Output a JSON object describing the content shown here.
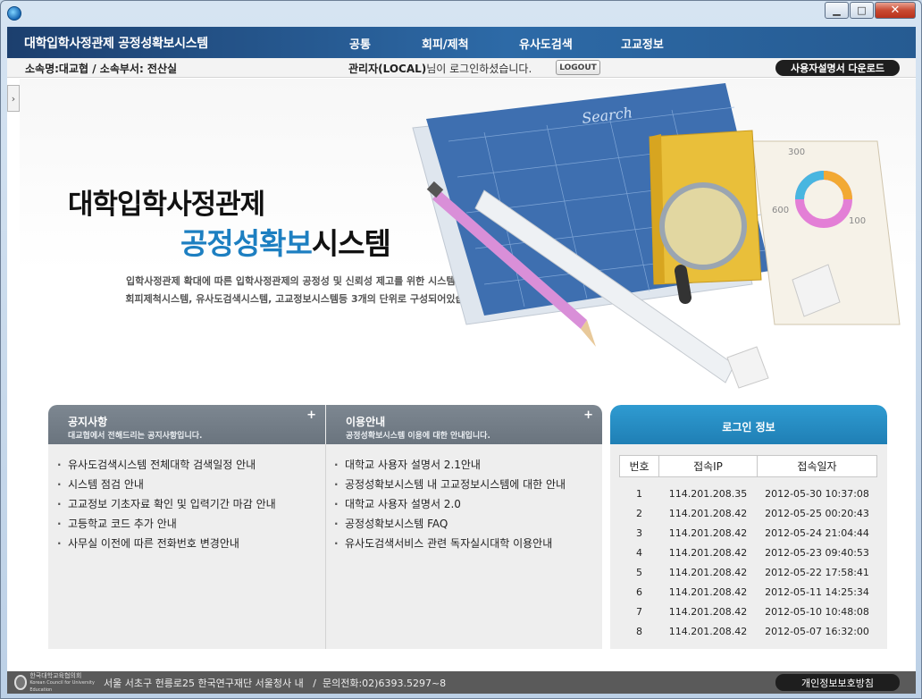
{
  "window": {
    "minimize": "▁",
    "maximize": "□",
    "close": "✕"
  },
  "header": {
    "brand": "대학입학사정관제 공정성확보시스템",
    "menu": [
      "공통",
      "회피/제척",
      "유사도검색",
      "고교정보"
    ]
  },
  "subbar": {
    "dept": "소속명:대교협 / 소속부서: 전산실",
    "login_user": "관리자(LOCAL)",
    "login_msg": "님이 로그인하셨습니다.",
    "logout": "LOGOUT",
    "manual": "사용자설명서 다운로드"
  },
  "sidebar_toggle": "›",
  "hero": {
    "title_line1": "대학입학사정관제",
    "title_accent": "공정성확보",
    "title_rest": "시스템",
    "desc_line1": "입학사정관제 확대에 따른 입학사정관제의 공정성 및 신뢰성 제고를 위한 시스템입니다.",
    "desc_line2": "회피제척시스템, 유사도검색시스템, 고교정보시스템등 3개의 단위로 구성되어있습니다.",
    "art": {
      "sketch_word": "Search",
      "chart_labels": [
        "300",
        "600",
        "100"
      ]
    }
  },
  "notice": {
    "title": "공지사항",
    "subtitle": "대교협에서 전해드리는 공지사항입니다.",
    "more": "+",
    "items": [
      "유사도검색시스템 전체대학 검색일정 안내",
      "시스템 점검 안내",
      "고교정보 기초자료 확인 및 입력기간 마감 안내",
      "고등학교 코드 추가 안내",
      "사무실 이전에 따른 전화번호 변경안내"
    ]
  },
  "guide": {
    "title": "이용안내",
    "subtitle": "공정성확보시스템 이용에 대한 안내입니다.",
    "more": "+",
    "items": [
      "대학교 사용자 설명서 2.1안내",
      "공정성확보시스템 내 고교정보시스템에 대한 안내",
      "대학교 사용자 설명서 2.0",
      "공정성확보시스템 FAQ",
      "유사도검색서비스 관련 독자실시대학 이용안내"
    ]
  },
  "login_info": {
    "title": "로그인 정보",
    "columns": [
      "번호",
      "접속IP",
      "접속일자"
    ],
    "rows": [
      [
        "1",
        "114.201.208.35",
        "2012-05-30 10:37:08"
      ],
      [
        "2",
        "114.201.208.42",
        "2012-05-25 00:20:43"
      ],
      [
        "3",
        "114.201.208.42",
        "2012-05-24 21:04:44"
      ],
      [
        "4",
        "114.201.208.42",
        "2012-05-23 09:40:53"
      ],
      [
        "5",
        "114.201.208.42",
        "2012-05-22 17:58:41"
      ],
      [
        "6",
        "114.201.208.42",
        "2012-05-11 14:25:34"
      ],
      [
        "7",
        "114.201.208.42",
        "2012-05-10 10:48:08"
      ],
      [
        "8",
        "114.201.208.42",
        "2012-05-07 16:32:00"
      ]
    ]
  },
  "footer": {
    "logo_text": "한국대학교육협의회",
    "logo_sub": "Korean Council for University Education",
    "address": "서울 서초구 헌릉로25 한국연구재단 서울청사 내",
    "separator": "/",
    "phone": "문의전화:02)6393.5297~8",
    "privacy": "개인정보보호방침"
  }
}
